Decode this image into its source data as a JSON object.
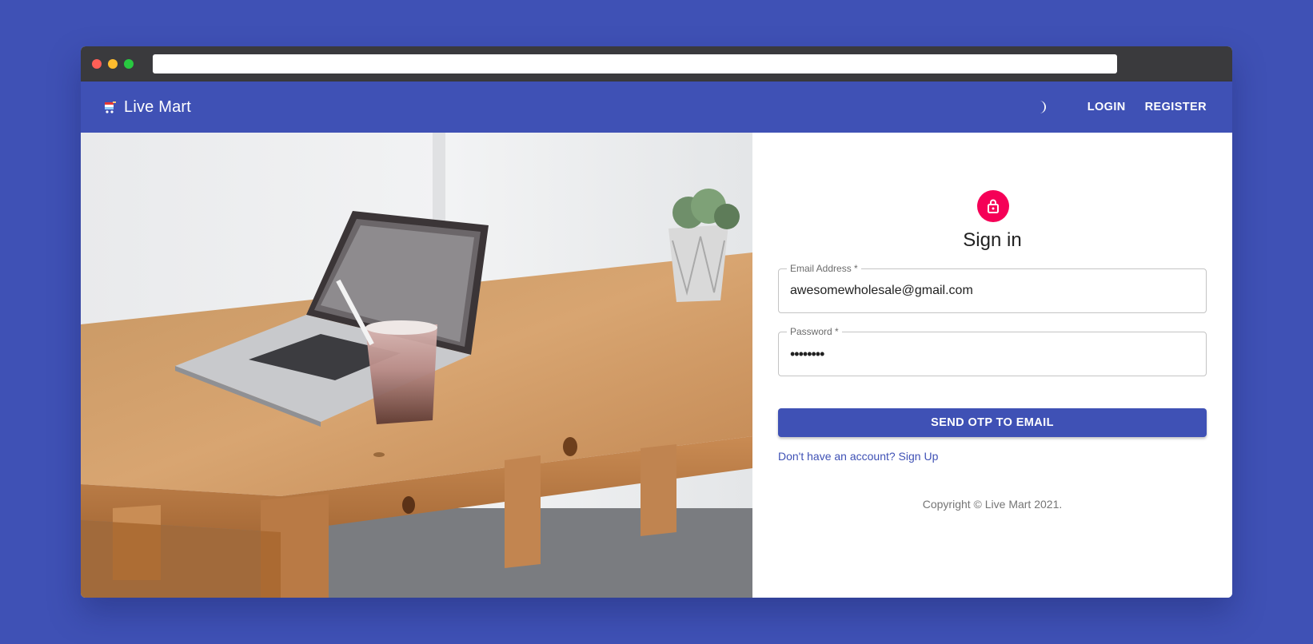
{
  "app": {
    "brand_title": "Live Mart",
    "brand_icon": "shop-cart-icon",
    "theme_toggle_icon": "moon-icon",
    "nav": {
      "login_label": "LOGIN",
      "register_label": "REGISTER"
    },
    "primary_color": "#3f51b5",
    "accent_color": "#f50057"
  },
  "signin": {
    "icon": "lock-icon",
    "heading": "Sign in",
    "email": {
      "label": "Email Address *",
      "value": "awesomewholesale@gmail.com"
    },
    "password": {
      "label": "Password *",
      "value": "••••••••"
    },
    "submit_label": "SEND OTP TO EMAIL",
    "signup_link": "Don't have an account? Sign Up",
    "copyright": "Copyright © Live Mart 2021."
  }
}
